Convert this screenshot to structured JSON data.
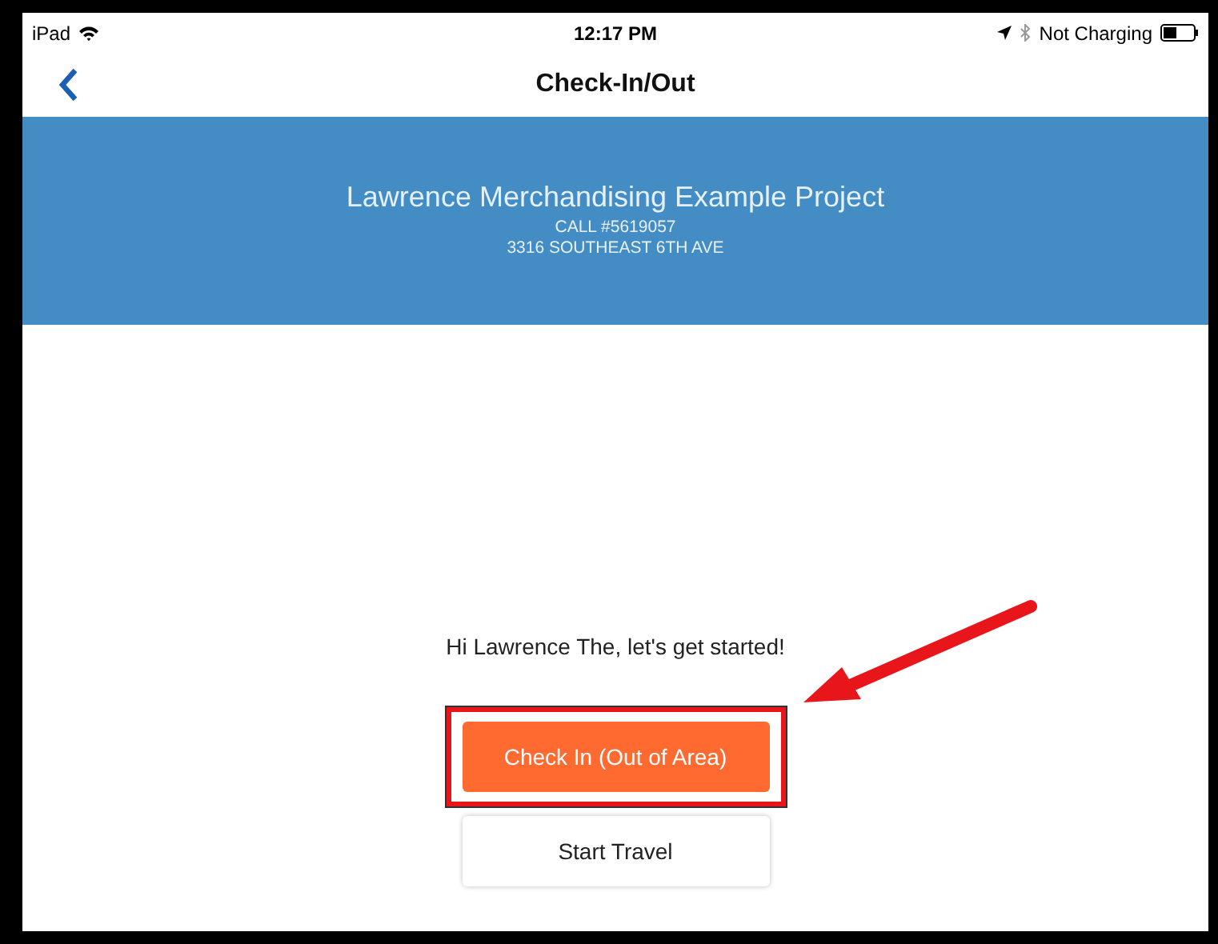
{
  "status_bar": {
    "device": "iPad",
    "time": "12:17 PM",
    "charging": "Not Charging"
  },
  "nav_bar": {
    "title": "Check-In/Out"
  },
  "header": {
    "project": "Lawrence Merchandising Example Project",
    "call": "CALL #5619057",
    "address": "3316 SOUTHEAST 6TH AVE"
  },
  "greeting": "Hi Lawrence The, let's get started!",
  "buttons": [
    {
      "label": "Check In (Out of Area)",
      "kind": "primary",
      "highlighted": true
    },
    {
      "label": "Start Travel",
      "kind": "secondary",
      "highlighted": false
    }
  ]
}
